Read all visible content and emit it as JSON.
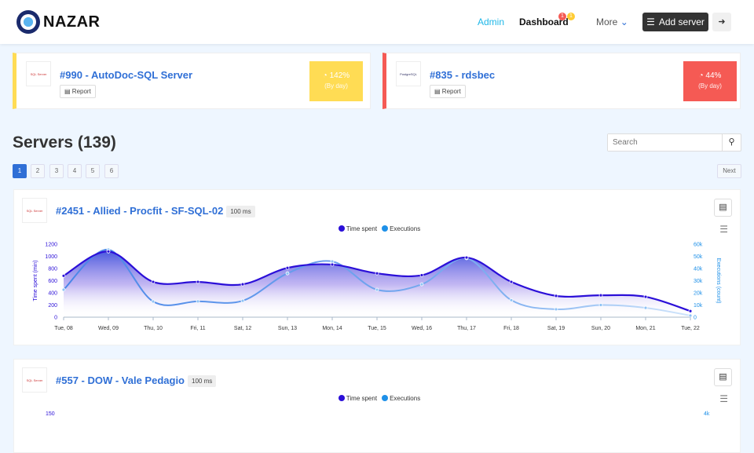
{
  "nav": {
    "brand": "NAZAR",
    "admin": "Admin",
    "dashboard": "Dashboard",
    "badge1": "1",
    "badge2": "1",
    "more": "More",
    "add_server": "Add server"
  },
  "top_cards": [
    {
      "title": "#990 - AutoDoc-SQL Server",
      "logo": "SQL Server",
      "report": "Report",
      "value": "142%",
      "period": "(By day)",
      "color": "#ffdc54"
    },
    {
      "title": "#835 - rdsbec",
      "logo": "PostgreSQL",
      "report": "Report",
      "value": "44%",
      "period": "(By day)",
      "color": "#f55a54"
    }
  ],
  "servers": {
    "heading": "Servers (139)",
    "search_placeholder": "Search",
    "pages": [
      "1",
      "2",
      "3",
      "4",
      "5",
      "6"
    ],
    "next": "Next"
  },
  "server_cards": [
    {
      "title": "#2451 - Allied - Procfit - SF-SQL-02",
      "badge": "100 ms",
      "logo": "SQL Server"
    },
    {
      "title": "#557 - DOW - Vale Pedagio",
      "badge": "100 ms",
      "logo": "SQL Server",
      "left_top": "150",
      "right_top": "4k"
    }
  ],
  "legend": {
    "time": "Time spent",
    "exec": "Executions"
  },
  "chart_data": {
    "type": "line",
    "categories": [
      "Tue, 08",
      "Wed, 09",
      "Thu, 10",
      "Fri, 11",
      "Sat, 12",
      "Sun, 13",
      "Mon, 14",
      "Tue, 15",
      "Wed, 16",
      "Thu, 17",
      "Fri, 18",
      "Sat, 19",
      "Sun, 20",
      "Mon, 21",
      "Tue, 22"
    ],
    "series": [
      {
        "name": "Time spent",
        "axis": "left",
        "color": "#2b0fd8",
        "values": [
          680,
          1080,
          580,
          580,
          540,
          810,
          865,
          720,
          690,
          980,
          580,
          350,
          360,
          335,
          100
        ]
      },
      {
        "name": "Executions",
        "axis": "right",
        "color": "#1e90e8",
        "values": [
          22600,
          55500,
          12900,
          13000,
          13500,
          36000,
          45800,
          22600,
          27000,
          48400,
          14000,
          6500,
          10000,
          7700,
          1300
        ]
      }
    ],
    "ylabel": "Time spent (min)",
    "y2label": "Executions (count)",
    "ylim": [
      0,
      1200
    ],
    "yticks": [
      "0",
      "200",
      "400",
      "600",
      "800",
      "1000",
      "1200"
    ],
    "y2lim": [
      0,
      60000
    ],
    "y2ticks": [
      "0",
      "10k",
      "20k",
      "30k",
      "40k",
      "50k",
      "60k"
    ],
    "legend": "top-center"
  }
}
